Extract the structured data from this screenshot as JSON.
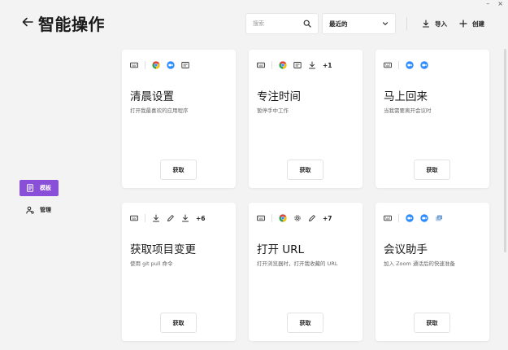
{
  "window_controls": {
    "minimize": "–",
    "close": "×"
  },
  "header": {
    "title": "智能操作",
    "back_icon": "arrow-left-icon",
    "search": {
      "placeholder": "搜索",
      "value": ""
    },
    "sort": {
      "selected": "最近的"
    },
    "import_label": "导入",
    "create_label": "创建"
  },
  "sidebar": {
    "items": [
      {
        "label": "模板",
        "icon": "template-icon",
        "active": true
      },
      {
        "label": "管理",
        "icon": "person-gear-icon",
        "active": false
      }
    ]
  },
  "colors": {
    "accent": "#8a4fd8",
    "chrome_red": "#e2463a",
    "chrome_yellow": "#f4c20d",
    "chrome_green": "#2fa24f",
    "chrome_blue": "#4285f4",
    "zoom_blue": "#2d8cff"
  },
  "cards": [
    {
      "title": "清晨设置",
      "desc": "打开我最喜欢的应用程序",
      "button": "获取",
      "icons": [
        "keyboard-icon",
        "chrome-icon",
        "zoom-icon",
        "window-icon"
      ],
      "more": ""
    },
    {
      "title": "专注时间",
      "desc": "暂停手中工作",
      "button": "获取",
      "icons": [
        "keyboard-icon",
        "chrome-icon",
        "window-icon",
        "download-icon"
      ],
      "more": "+1"
    },
    {
      "title": "马上回来",
      "desc": "当我需要离开会议时",
      "button": "获取",
      "icons": [
        "keyboard-icon",
        "zoom-icon",
        "zoom-icon"
      ],
      "more": ""
    },
    {
      "title": "获取项目变更",
      "desc": "使用 git pull 命令",
      "button": "获取",
      "icons": [
        "keyboard-icon",
        "download-icon",
        "pencil-icon",
        "download-icon"
      ],
      "more": "+6"
    },
    {
      "title": "打开 URL",
      "desc": "打开浏览器时，打开我收藏的 URL",
      "button": "获取",
      "icons": [
        "keyboard-icon",
        "chrome-icon",
        "gear-icon",
        "pencil-icon"
      ],
      "more": "+7"
    },
    {
      "title": "会议助手",
      "desc": "加入 Zoom 通话后的快速准备",
      "button": "获取",
      "icons": [
        "keyboard-icon",
        "zoom-icon",
        "zoom-icon",
        "app-icon"
      ],
      "more": ""
    }
  ]
}
